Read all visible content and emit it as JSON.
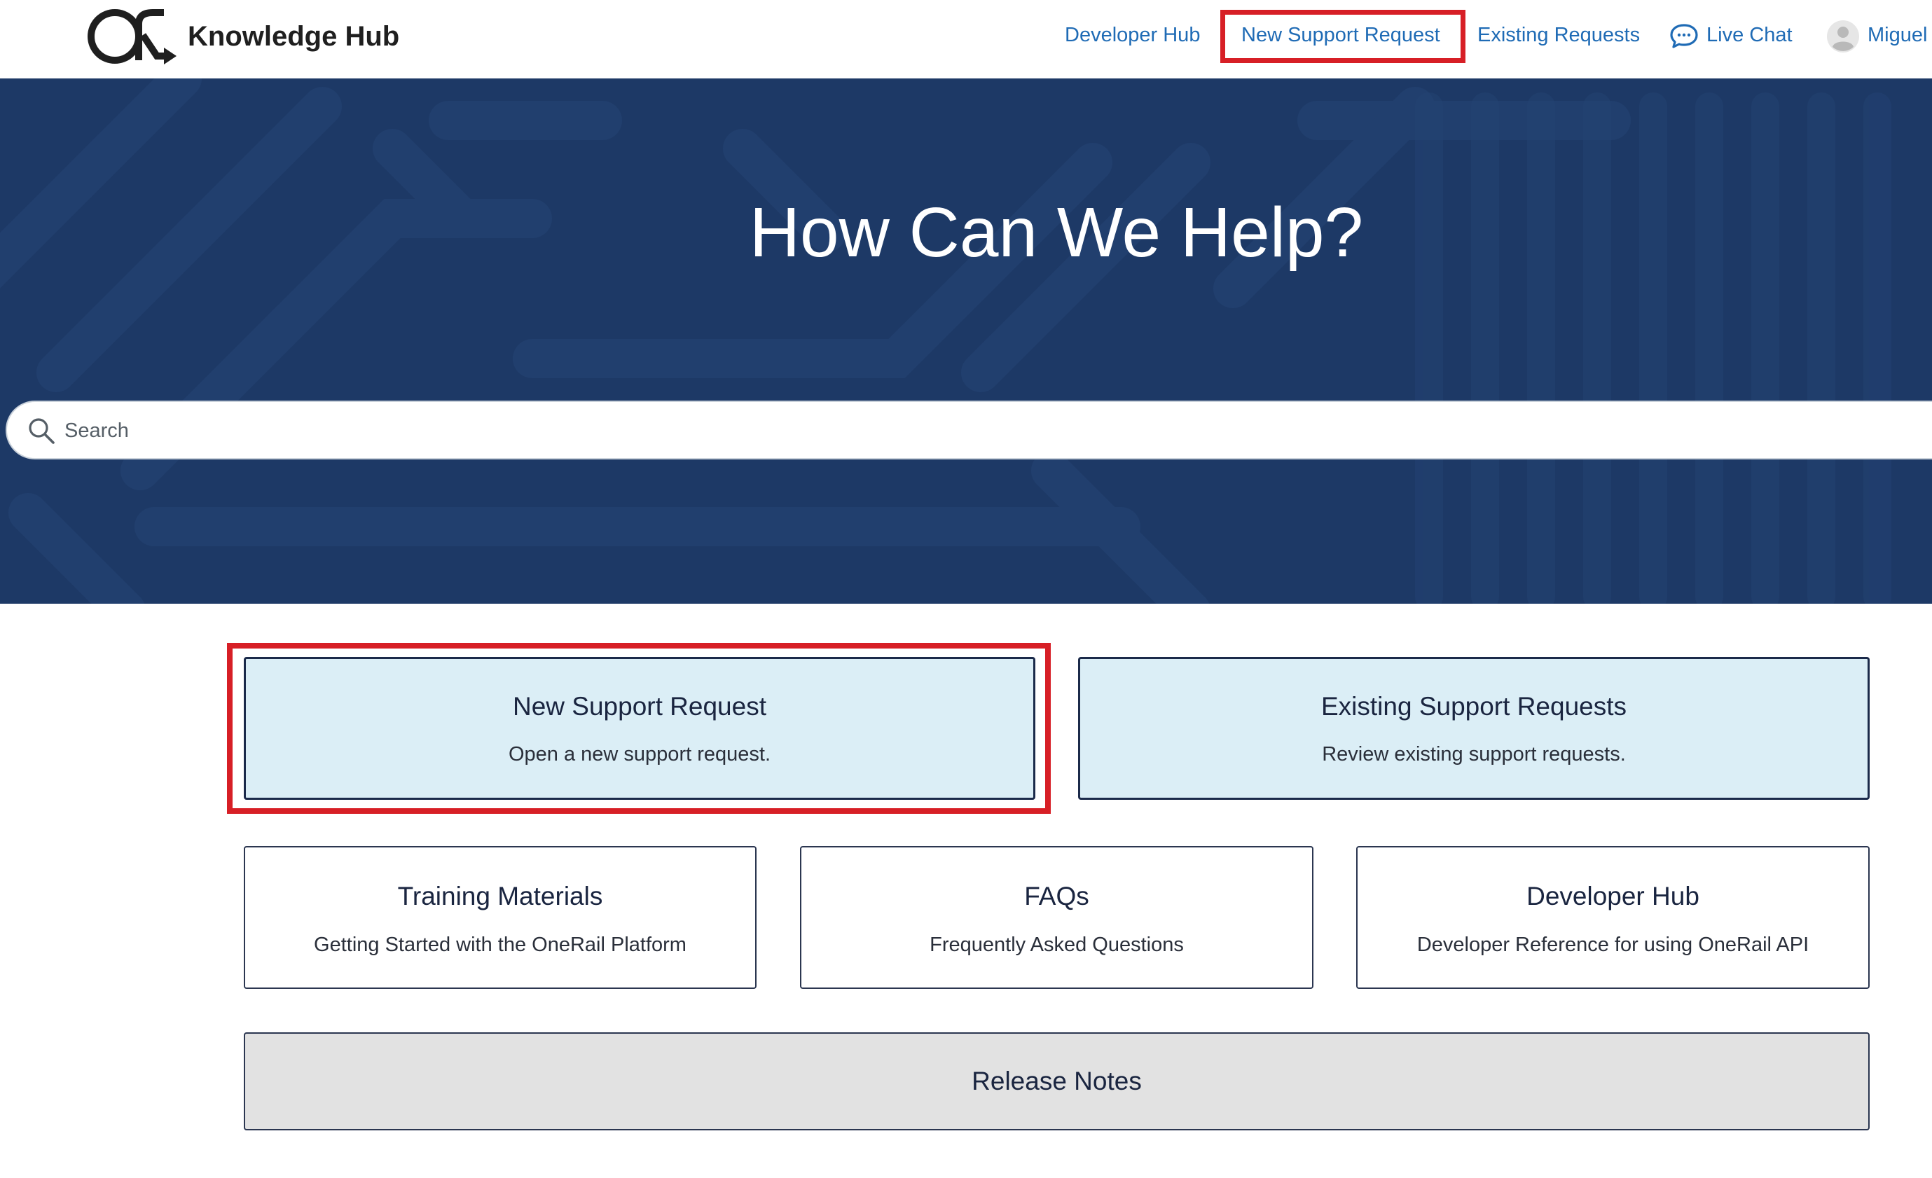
{
  "header": {
    "brand": "Knowledge Hub",
    "nav": {
      "developer_hub": "Developer Hub",
      "new_support_request": "New Support Request",
      "existing_requests": "Existing Requests",
      "live_chat": "Live Chat",
      "user": "Miguel"
    },
    "link_color": "#1f6bb5",
    "highlight_color": "#d71f26"
  },
  "hero": {
    "title": "How Can We Help?",
    "background": "#1e3a66"
  },
  "search": {
    "placeholder": "Search",
    "value": ""
  },
  "cards": {
    "new_support": {
      "title": "New Support Request",
      "description": "Open a new support request."
    },
    "existing_support": {
      "title": "Existing Support Requests",
      "description": "Review existing support requests."
    },
    "training": {
      "title": "Training Materials",
      "description": "Getting Started with the OneRail Platform"
    },
    "faqs": {
      "title": "FAQs",
      "description": "Frequently Asked Questions"
    },
    "developer_hub": {
      "title": "Developer Hub",
      "description": "Developer Reference for using OneRail API"
    },
    "release_notes": {
      "title": "Release Notes"
    }
  },
  "icons": {
    "logo": "onerail-logo-icon",
    "chat": "chat-bubble-icon",
    "avatar": "user-avatar-icon",
    "search": "search-icon"
  }
}
